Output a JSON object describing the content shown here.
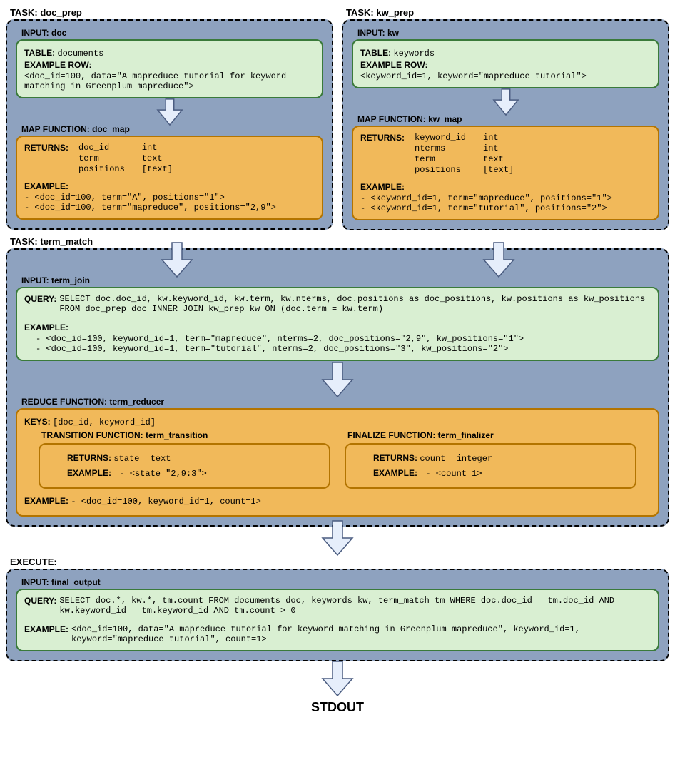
{
  "doc_prep": {
    "task_label": "TASK: doc_prep",
    "input_label": "INPUT: doc",
    "table_label": "TABLE:",
    "table_value": "documents",
    "example_row_label": "EXAMPLE ROW:",
    "example_row": "<doc_id=100, data=\"A mapreduce tutorial for keyword matching in Greenplum mapreduce\">",
    "map_label": "MAP FUNCTION: doc_map",
    "returns_label": "RETURNS:",
    "returns": [
      {
        "name": "doc_id",
        "type": "int"
      },
      {
        "name": "term",
        "type": "text"
      },
      {
        "name": "positions",
        "type": "[text]"
      }
    ],
    "example_label": "EXAMPLE:",
    "example_lines": [
      "- <doc_id=100, term=\"A\", positions=\"1\">",
      "- <doc_id=100, term=\"mapreduce\", positions=\"2,9\">"
    ]
  },
  "kw_prep": {
    "task_label": "TASK: kw_prep",
    "input_label": "INPUT: kw",
    "table_label": "TABLE:",
    "table_value": "keywords",
    "example_row_label": "EXAMPLE ROW:",
    "example_row": "<keyword_id=1, keyword=\"mapreduce tutorial\">",
    "map_label": "MAP FUNCTION: kw_map",
    "returns_label": "RETURNS:",
    "returns": [
      {
        "name": "keyword_id",
        "type": "int"
      },
      {
        "name": "nterms",
        "type": "int"
      },
      {
        "name": "term",
        "type": "text"
      },
      {
        "name": "positions",
        "type": "[text]"
      }
    ],
    "example_label": "EXAMPLE:",
    "example_lines": [
      "- <keyword_id=1, term=\"mapreduce\", positions=\"1\">",
      "- <keyword_id=1, term=\"tutorial\", positions=\"2\">"
    ]
  },
  "term_match": {
    "task_label": "TASK: term_match",
    "input_label": "INPUT: term_join",
    "query_label": "QUERY:",
    "query": "SELECT doc.doc_id, kw.keyword_id, kw.term, kw.nterms, doc.positions as doc_positions, kw.positions as kw_positions FROM doc_prep doc INNER JOIN kw_prep kw ON (doc.term = kw.term)",
    "example_label": "EXAMPLE:",
    "example_lines": [
      "- <doc_id=100, keyword_id=1, term=\"mapreduce\", nterms=2, doc_positions=\"2,9\", kw_positions=\"1\">",
      "- <doc_id=100, keyword_id=1, term=\"tutorial\", nterms=2, doc_positions=\"3\", kw_positions=\"2\">"
    ],
    "reduce_label": "REDUCE FUNCTION: term_reducer",
    "keys_label": "KEYS:",
    "keys": "[doc_id, keyword_id]",
    "transition": {
      "title": "TRANSITION FUNCTION: term_transition",
      "returns_label": "RETURNS:",
      "returns_name": "state",
      "returns_type": "text",
      "example_label": "EXAMPLE:",
      "example": "- <state=\"2,9:3\">"
    },
    "finalize": {
      "title": "FINALIZE FUNCTION: term_finalizer",
      "returns_label": "RETURNS:",
      "returns_name": "count",
      "returns_type": "integer",
      "example_label": "EXAMPLE:",
      "example": "- <count=1>"
    },
    "reduce_example_label": "EXAMPLE:",
    "reduce_example": "- <doc_id=100, keyword_id=1, count=1>"
  },
  "execute": {
    "label": "EXECUTE:",
    "input_label": "INPUT: final_output",
    "query_label": "QUERY:",
    "query": "SELECT doc.*, kw.*, tm.count FROM documents doc, keywords kw, term_match tm WHERE doc.doc_id = tm.doc_id AND kw.keyword_id = tm.keyword_id AND tm.count > 0",
    "example_label": "EXAMPLE:",
    "example": "<doc_id=100, data=\"A mapreduce tutorial for keyword matching in Greenplum mapreduce\", keyword_id=1, keyword=\"mapreduce tutorial\", count=1>"
  },
  "stdout": "STDOUT"
}
